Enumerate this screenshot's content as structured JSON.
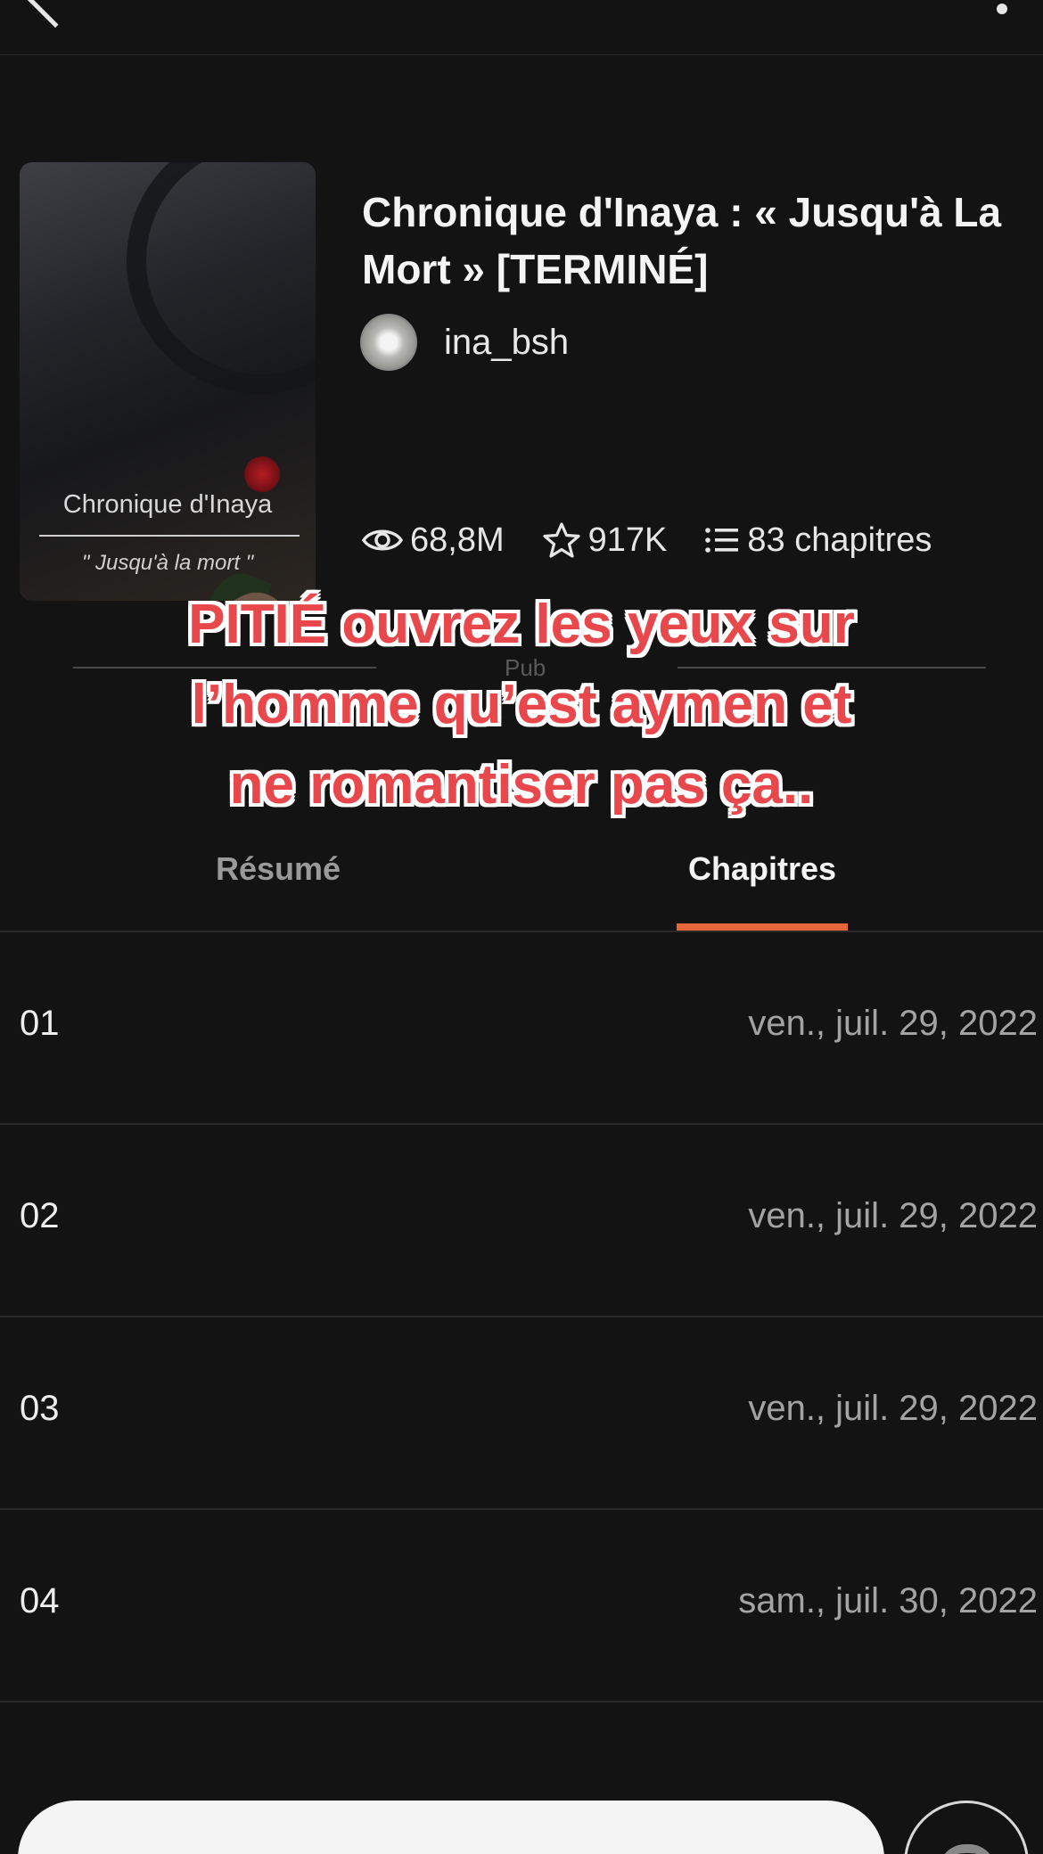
{
  "story": {
    "title": "Chronique d'Inaya : « Jusqu'à La Mort » [TERMINÉ]",
    "cover_title": "Chronique d'Inaya",
    "cover_subtitle": "\" Jusqu'à la mort \"",
    "author": "ina_bsh",
    "views": "68,8M",
    "votes": "917K",
    "chapters_count": "83 chapitres"
  },
  "ad": {
    "label": "Pub"
  },
  "overlay_caption": [
    "PITIÉ ouvrez les yeux sur",
    "l’homme qu’est aymen et",
    "ne romantiser pas ça.."
  ],
  "tabs": [
    {
      "label": "Résumé",
      "active": false
    },
    {
      "label": "Chapitres",
      "active": true
    }
  ],
  "chapters": [
    {
      "number": "01",
      "date": "ven., juil. 29, 2022"
    },
    {
      "number": "02",
      "date": "ven., juil. 29, 2022"
    },
    {
      "number": "03",
      "date": "ven., juil. 29, 2022"
    },
    {
      "number": "04",
      "date": "sam., juil. 30, 2022"
    }
  ],
  "icons": {
    "back": "chevron-left-icon",
    "more": "more-vertical-icon",
    "views": "eye-icon",
    "votes": "star-icon",
    "chapters": "list-icon"
  },
  "colors": {
    "background": "#131313",
    "accent": "#e4683b",
    "caption_red": "#e8474c"
  }
}
